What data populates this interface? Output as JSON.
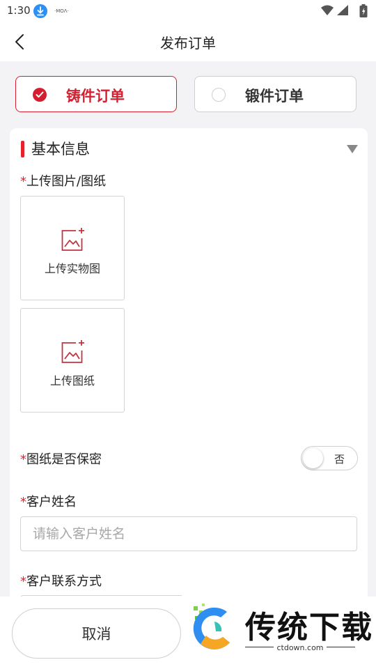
{
  "status_bar": {
    "time": "1:30",
    "notif_mini_text": "·ΜΟΛ·"
  },
  "nav": {
    "title": "发布订单"
  },
  "order_types": [
    {
      "label": "铸件订单",
      "selected": true
    },
    {
      "label": "锻件订单",
      "selected": false
    }
  ],
  "section": {
    "title": "基本信息"
  },
  "required_mark": "*",
  "fields": {
    "upload": {
      "label": "上传图片/图纸",
      "photo_button": "上传实物图",
      "drawing_button": "上传图纸"
    },
    "confidential": {
      "label": "图纸是否保密",
      "toggle_text": "否"
    },
    "customer_name": {
      "label": "客户姓名",
      "value": "",
      "placeholder": "请输入客户姓名"
    },
    "customer_contact": {
      "label": "客户联系方式"
    }
  },
  "bottom": {
    "cancel_label": "取消"
  },
  "watermark": {
    "name": "传统下载",
    "url": "ctdown.com"
  },
  "colors": {
    "accent": "#d51f30",
    "section_bar": "#e8202e",
    "border": "#d4d4d4",
    "placeholder": "#a8a8a8"
  }
}
